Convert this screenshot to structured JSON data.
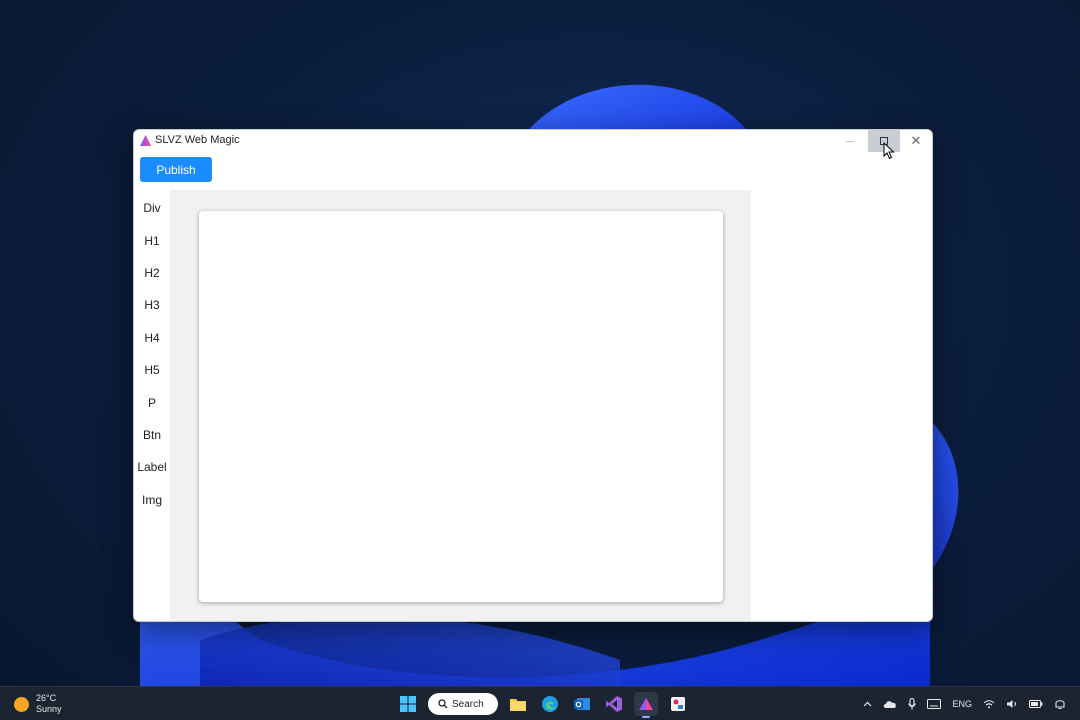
{
  "window": {
    "title": "SLVZ Web Magic",
    "minimize_icon": "minimize-icon",
    "maximize_icon": "maximize-icon",
    "close_icon": "close-icon",
    "close_glyph": "✕",
    "minimize_glyph": "—"
  },
  "toolbar": {
    "publish_label": "Publish"
  },
  "palette": {
    "items": [
      "Div",
      "H1",
      "H2",
      "H3",
      "H4",
      "H5",
      "P",
      "Btn",
      "Label",
      "Img"
    ]
  },
  "taskbar": {
    "weather": {
      "temp": "26°C",
      "condition": "Sunny"
    },
    "search_label": "Search",
    "language": "ENG"
  },
  "colors": {
    "accent": "#1a8cff",
    "canvas_bg": "#f1f1f1",
    "taskbar": "#1d2431"
  }
}
